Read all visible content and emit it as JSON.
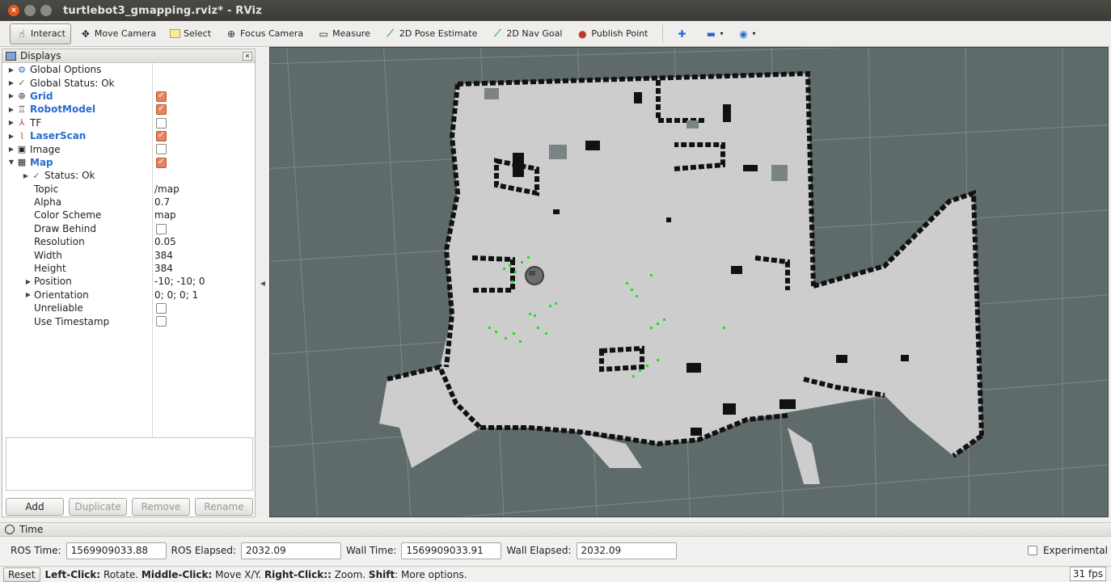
{
  "window": {
    "title": "turtlebot3_gmapping.rviz* - RViz"
  },
  "toolbar": {
    "tools": [
      {
        "label": "Interact",
        "icon": "hand-pointer-icon",
        "active": true
      },
      {
        "label": "Move Camera",
        "icon": "move-camera-icon"
      },
      {
        "label": "Select",
        "icon": "select-rect-icon"
      },
      {
        "label": "Focus Camera",
        "icon": "focus-camera-icon"
      },
      {
        "label": "Measure",
        "icon": "measure-icon"
      },
      {
        "label": "2D Pose Estimate",
        "icon": "pose-arrow-icon"
      },
      {
        "label": "2D Nav Goal",
        "icon": "nav-arrow-icon"
      },
      {
        "label": "Publish Point",
        "icon": "map-pin-icon"
      }
    ]
  },
  "displays": {
    "title": "Displays",
    "items": [
      {
        "label": "Global Options",
        "icon": "gear-icon",
        "style": "normal",
        "checkbox": null
      },
      {
        "label": "Global Status: Ok",
        "icon": "check-icon",
        "style": "normal",
        "checkbox": null
      },
      {
        "label": "Grid",
        "icon": "grid-icon",
        "style": "blue",
        "checkbox": true
      },
      {
        "label": "RobotModel",
        "icon": "robot-icon",
        "style": "blue",
        "checkbox": true
      },
      {
        "label": "TF",
        "icon": "tf-axes-icon",
        "style": "normal",
        "checkbox": false
      },
      {
        "label": "LaserScan",
        "icon": "laser-icon",
        "style": "blue",
        "checkbox": true
      },
      {
        "label": "Image",
        "icon": "image-icon",
        "style": "normal",
        "checkbox": false
      },
      {
        "label": "Map",
        "icon": "map-icon",
        "style": "blue",
        "checkbox": true
      }
    ],
    "map_children": {
      "status": "Status: Ok",
      "props": [
        {
          "key": "Topic",
          "value": "/map"
        },
        {
          "key": "Alpha",
          "value": "0.7"
        },
        {
          "key": "Color Scheme",
          "value": "map"
        },
        {
          "key": "Draw Behind",
          "value": "",
          "checkbox": false
        },
        {
          "key": "Resolution",
          "value": "0.05"
        },
        {
          "key": "Width",
          "value": "384"
        },
        {
          "key": "Height",
          "value": "384"
        },
        {
          "key": "Position",
          "value": "-10; -10; 0",
          "expandable": true
        },
        {
          "key": "Orientation",
          "value": "0; 0; 0; 1",
          "expandable": true
        },
        {
          "key": "Unreliable",
          "value": "",
          "checkbox": false
        },
        {
          "key": "Use Timestamp",
          "value": "",
          "checkbox": false
        }
      ]
    },
    "buttons": {
      "add": "Add",
      "duplicate": "Duplicate",
      "remove": "Remove",
      "rename": "Rename"
    }
  },
  "time": {
    "title": "Time",
    "ros_time_label": "ROS Time:",
    "ros_time": "1569909033.88",
    "ros_elapsed_label": "ROS Elapsed:",
    "ros_elapsed": "2032.09",
    "wall_time_label": "Wall Time:",
    "wall_time": "1569909033.91",
    "wall_elapsed_label": "Wall Elapsed:",
    "wall_elapsed": "2032.09",
    "experimental": "Experimental"
  },
  "status": {
    "reset": "Reset",
    "k1": "Left-Click:",
    "v1": " Rotate. ",
    "k2": "Middle-Click:",
    "v2": " Move X/Y. ",
    "k3": "Right-Click::",
    "v3": " Zoom. ",
    "k4": "Shift",
    "v4": ": More options.",
    "fps": "31 fps"
  },
  "colors": {
    "accent_orange": "#e95420",
    "checkbox_checked": "#e9825c",
    "display_blue": "#2a6bd0",
    "map_free": "#cdcdcd",
    "map_occupied": "#111111",
    "background": "#5f6b6b",
    "laser_green": "#22dd22"
  }
}
